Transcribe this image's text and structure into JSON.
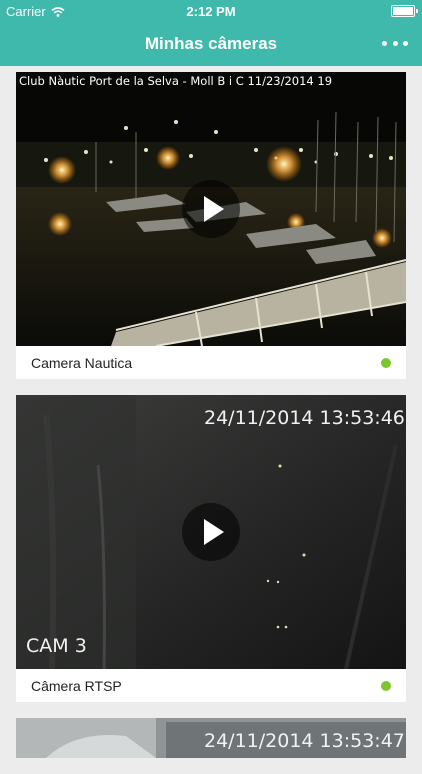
{
  "status_bar": {
    "carrier": "Carrier",
    "time": "2:12 PM"
  },
  "nav": {
    "title": "Minhas câmeras",
    "menu_icon": "more-dots-icon"
  },
  "colors": {
    "header": "#3fb9ab",
    "online": "#7cc62e"
  },
  "cameras": [
    {
      "name": "Camera Nautica",
      "overlay": "Club Nàutic Port de la Selva - Moll B i C 11/23/2014 19",
      "online": true
    },
    {
      "name": "Câmera RTSP",
      "overlay_time": "24/11/2014 13:53:46",
      "overlay_label": "CAM 3",
      "online": true
    },
    {
      "name": "",
      "overlay_time": "24/11/2014 13:53:47"
    }
  ]
}
